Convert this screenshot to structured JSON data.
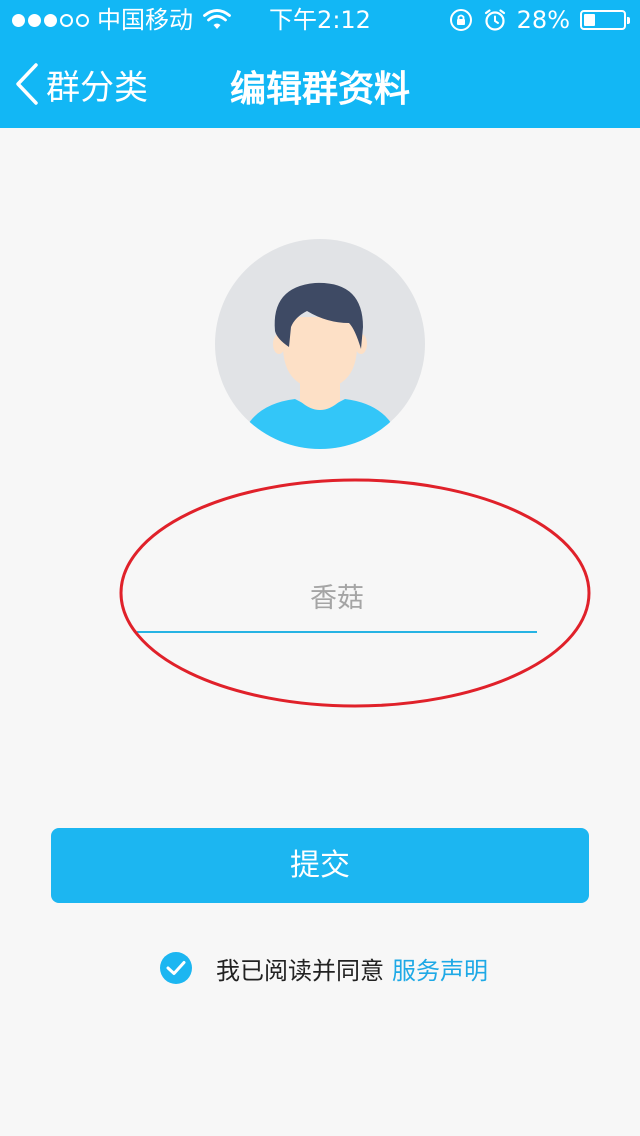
{
  "status_bar": {
    "carrier": "中国移动",
    "time": "下午2:12",
    "battery_percent": "28%",
    "battery_level": 0.28,
    "signal_filled": 3,
    "signal_total": 5,
    "icons": [
      "wifi-icon",
      "rotation-lock-icon",
      "alarm-icon",
      "battery-icon"
    ]
  },
  "nav": {
    "back_label": "群分类",
    "title": "编辑群资料"
  },
  "avatar": {
    "icon": "default-avatar-icon"
  },
  "name_input": {
    "placeholder": "香菇",
    "value": ""
  },
  "submit": {
    "label": "提交"
  },
  "agreement": {
    "checked": true,
    "text": "我已阅读并同意",
    "link": "服务声明"
  },
  "colors": {
    "header": "#12b7f5",
    "accent": "#1cb6f1",
    "link": "#1ea9e6",
    "highlight_ellipse": "#e0212a",
    "background": "#f7f7f7"
  }
}
